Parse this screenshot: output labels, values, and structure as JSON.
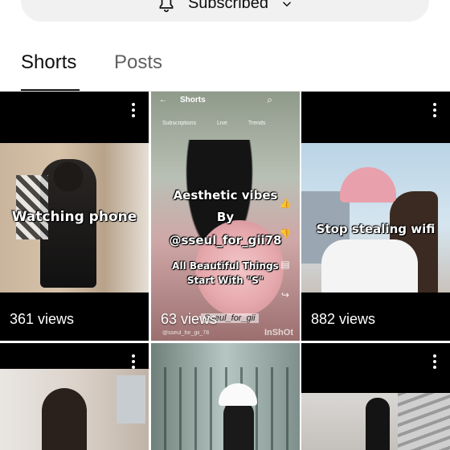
{
  "subscribe": {
    "label": "Subscribed"
  },
  "tabs": [
    {
      "label": "Shorts",
      "active": true
    },
    {
      "label": "Posts",
      "active": false
    }
  ],
  "shorts": [
    {
      "overlay": [
        "Watching phone"
      ],
      "views": "361 views"
    },
    {
      "overlay": [
        "Aesthetic vibes",
        "By",
        "@sseul_for_gii78",
        "All Beautiful Things",
        "Start With \"S\""
      ],
      "views": "63 views",
      "inner": {
        "header_title": "Shorts",
        "chips": [
          "Subscriptions",
          "Live",
          "Trends"
        ],
        "signature": "Sseul_for_gii",
        "account": "@sseul_for_gii_78",
        "watermark": "InShOt"
      }
    },
    {
      "overlay": [
        "Stop stealing wifi"
      ],
      "views": "882 views"
    },
    {
      "overlay": [],
      "views": ""
    },
    {
      "overlay": [],
      "views": ""
    },
    {
      "overlay": [],
      "views": ""
    }
  ],
  "colors": {
    "text_primary": "#0f0f0f",
    "text_secondary": "#606060",
    "pill_bg": "#f1f1f1"
  },
  "icons": {
    "bell": "bell-icon",
    "chevron": "chevron-down-icon",
    "menu": "more-vert-icon"
  }
}
